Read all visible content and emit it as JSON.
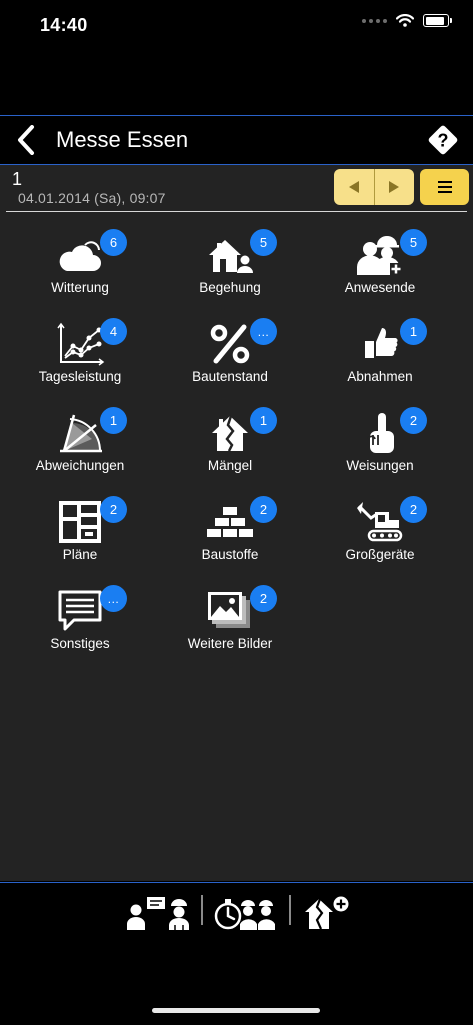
{
  "status": {
    "time": "14:40"
  },
  "header": {
    "title": "Messe Essen"
  },
  "record": {
    "number": "1",
    "datetime": "04.01.2014 (Sa), 09:07"
  },
  "tiles": [
    {
      "label": "Witterung",
      "badge": "6",
      "icon": "weather-cloud-icon"
    },
    {
      "label": "Begehung",
      "badge": "5",
      "icon": "house-person-icon"
    },
    {
      "label": "Anwesende",
      "badge": "5",
      "icon": "workers-icon"
    },
    {
      "label": "Tagesleistung",
      "badge": "4",
      "icon": "line-chart-icon"
    },
    {
      "label": "Bautenstand",
      "badge": "...",
      "icon": "percent-icon"
    },
    {
      "label": "Abnahmen",
      "badge": "1",
      "icon": "thumbs-up-icon"
    },
    {
      "label": "Abweichungen",
      "badge": "1",
      "icon": "protractor-icon"
    },
    {
      "label": "Mängel",
      "badge": "1",
      "icon": "cracked-house-icon"
    },
    {
      "label": "Weisungen",
      "badge": "2",
      "icon": "pointing-hand-icon"
    },
    {
      "label": "Pläne",
      "badge": "2",
      "icon": "floor-plan-icon"
    },
    {
      "label": "Baustoffe",
      "badge": "2",
      "icon": "bricks-icon"
    },
    {
      "label": "Großgeräte",
      "badge": "2",
      "icon": "excavator-icon"
    },
    {
      "label": "Sonstiges",
      "badge": "...",
      "icon": "speech-bubble-icon"
    },
    {
      "label": "Weitere Bilder",
      "badge": "2",
      "icon": "photos-icon"
    }
  ],
  "bottom_tabs": [
    {
      "icon": "meeting-workers-icon"
    },
    {
      "icon": "stopwatch-workers-icon"
    },
    {
      "icon": "add-defect-icon"
    }
  ],
  "colors": {
    "accent_blue": "#1a7ef2",
    "pager_yellow": "#f7e08a",
    "menu_yellow": "#f5d24d",
    "panel": "#232323"
  }
}
